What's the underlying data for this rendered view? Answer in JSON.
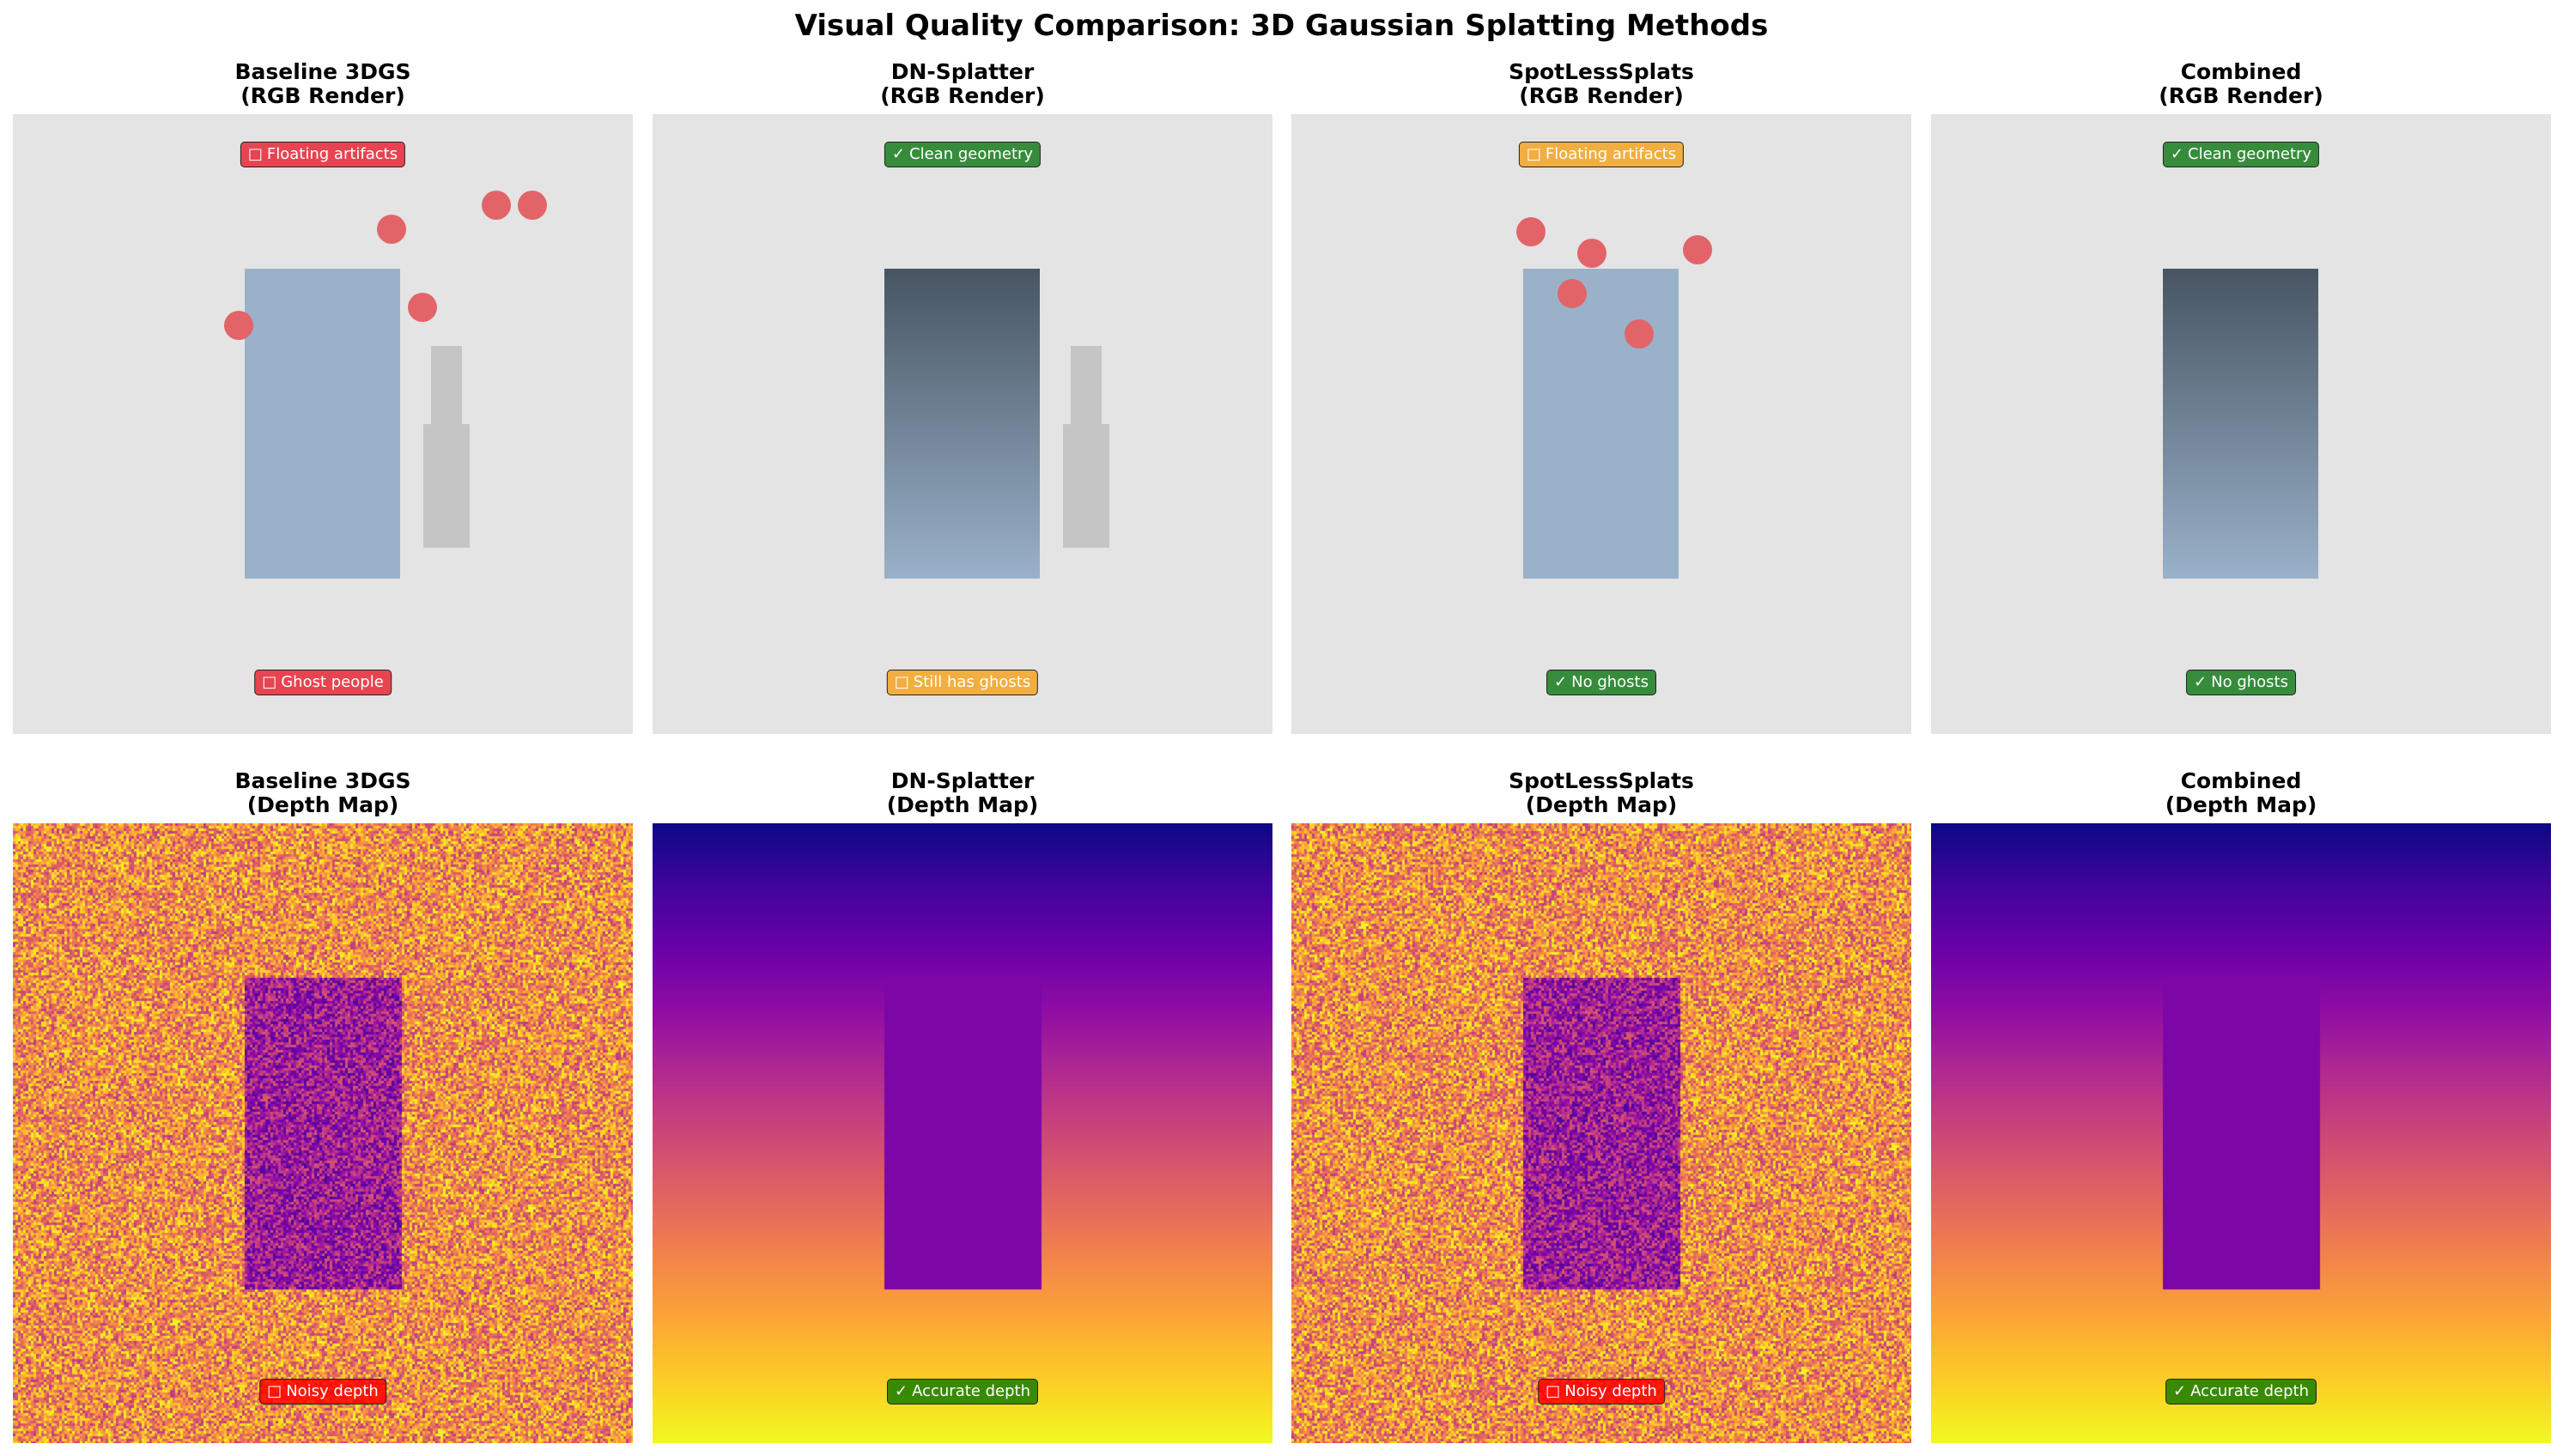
{
  "title": "Visual Quality Comparison: 3D Gaussian Splatting Methods",
  "panels": [
    {
      "title_line1": "Baseline 3DGS",
      "title_line2": "(RGB Render)",
      "kind": "rgb",
      "object_fill": "flat",
      "second_object": true,
      "floaters": true,
      "top_badge": {
        "icon": "x-icon",
        "glyph": "□",
        "text": "Floating artifacts",
        "color": "red"
      },
      "bottom_badge": {
        "icon": "x-icon",
        "glyph": "□",
        "text": "Ghost people",
        "color": "red"
      }
    },
    {
      "title_line1": "DN-Splatter",
      "title_line2": "(RGB Render)",
      "kind": "rgb",
      "object_fill": "gradient",
      "second_object": true,
      "floaters": false,
      "top_badge": {
        "icon": "check-icon",
        "glyph": "✓",
        "text": "Clean geometry",
        "color": "green"
      },
      "bottom_badge": {
        "icon": "warning-icon",
        "glyph": "□",
        "text": "Still has ghosts",
        "color": "amber"
      }
    },
    {
      "title_line1": "SpotLessSplats",
      "title_line2": "(RGB Render)",
      "kind": "rgb",
      "object_fill": "flat",
      "second_object": false,
      "floaters": true,
      "top_badge": {
        "icon": "warning-icon",
        "glyph": "□",
        "text": "Floating artifacts",
        "color": "amber"
      },
      "bottom_badge": {
        "icon": "check-icon",
        "glyph": "✓",
        "text": "No ghosts",
        "color": "green"
      }
    },
    {
      "title_line1": "Combined",
      "title_line2": "(RGB Render)",
      "kind": "rgb",
      "object_fill": "gradient",
      "second_object": false,
      "floaters": false,
      "top_badge": {
        "icon": "check-icon",
        "glyph": "✓",
        "text": "Clean geometry",
        "color": "green"
      },
      "bottom_badge": {
        "icon": "check-icon",
        "glyph": "✓",
        "text": "No ghosts",
        "color": "green"
      }
    },
    {
      "title_line1": "Baseline 3DGS",
      "title_line2": "(Depth Map)",
      "kind": "depth-noisy",
      "bottom_badge": {
        "icon": "x-icon",
        "glyph": "□",
        "text": "Noisy depth",
        "color": "brightred"
      }
    },
    {
      "title_line1": "DN-Splatter",
      "title_line2": "(Depth Map)",
      "kind": "depth-smooth",
      "bottom_badge": {
        "icon": "check-icon",
        "glyph": "✓",
        "text": "Accurate depth",
        "color": "dgreen"
      }
    },
    {
      "title_line1": "SpotLessSplats",
      "title_line2": "(Depth Map)",
      "kind": "depth-noisy",
      "bottom_badge": {
        "icon": "x-icon",
        "glyph": "□",
        "text": "Noisy depth",
        "color": "brightred"
      }
    },
    {
      "title_line1": "Combined",
      "title_line2": "(Depth Map)",
      "kind": "depth-smooth",
      "bottom_badge": {
        "icon": "check-icon",
        "glyph": "✓",
        "text": "Accurate depth",
        "color": "dgreen"
      }
    }
  ],
  "colors": {
    "background": "#e4e4e4",
    "object_flat": "#9ab1c9",
    "object_gradient_top": "#475563",
    "object_gradient_bottom": "#9ab1c9",
    "second_object": "#c5c5c5",
    "floater": "#e36468"
  }
}
